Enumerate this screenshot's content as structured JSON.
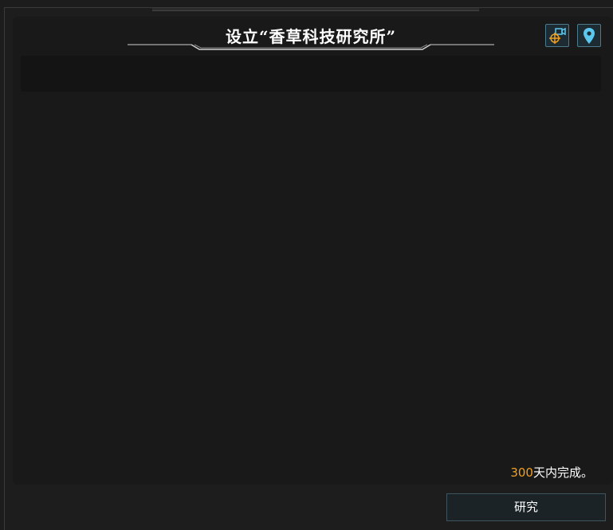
{
  "dialog": {
    "title": "设立“香草科技研究所”",
    "icons": {
      "camera_target": "camera-target-icon",
      "location": "location-pin-icon"
    },
    "status": {
      "days": "300",
      "suffix": "天内完成。"
    },
    "research_button_label": "研究"
  },
  "colors": {
    "accent_orange": "#f0a020",
    "icon_blue": "#5cc8ef",
    "button_border": "#3e5560"
  }
}
